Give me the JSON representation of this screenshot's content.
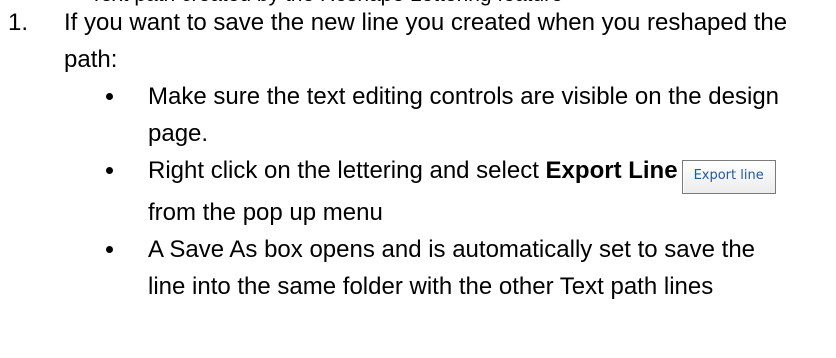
{
  "header_fragment": "Text path created by the Reshape Lettering feature",
  "step": {
    "number": "1.",
    "intro": "If you want to save the new line you created when you reshaped the path:"
  },
  "bullets": {
    "b1": "Make sure the text editing controls are visible on the design page.",
    "b2_prefix": "Right click on the lettering and select ",
    "b2_bold": "Export Line",
    "b2_button": "Export line",
    "b2_suffix": " from the pop up menu",
    "b3": "A Save As box opens and is automatically set to save the line into the same folder with the other Text path lines"
  }
}
